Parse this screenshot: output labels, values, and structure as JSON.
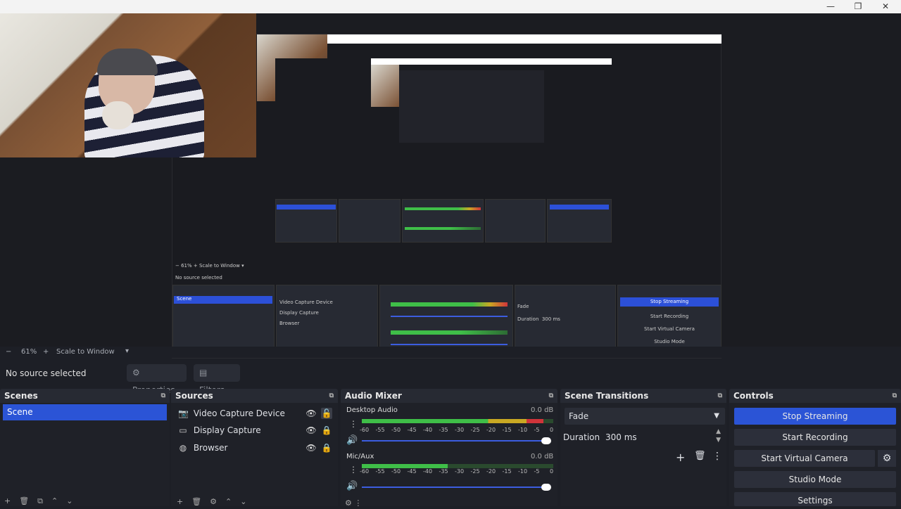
{
  "window": {
    "controls": {
      "minimize": "—",
      "maximize": "❐",
      "close": "✕"
    }
  },
  "preview": {
    "zoom_label": "61%",
    "scale_label": "Scale to Window",
    "minus": "−",
    "plus": "+",
    "dropdown": "▾"
  },
  "source_toolbar": {
    "status": "No source selected",
    "properties": "Properties",
    "filters": "Filters"
  },
  "scenes": {
    "title": "Scenes",
    "items": [
      {
        "label": "Scene"
      }
    ]
  },
  "sources": {
    "title": "Sources",
    "items": [
      {
        "label": "Video Capture Device",
        "icon": "camera-icon"
      },
      {
        "label": "Display Capture",
        "icon": "monitor-icon"
      },
      {
        "label": "Browser",
        "icon": "globe-icon"
      }
    ]
  },
  "mixer": {
    "title": "Audio Mixer",
    "channels": [
      {
        "name": "Desktop Audio",
        "db": "0.0 dB",
        "level": 0.95
      },
      {
        "name": "Mic/Aux",
        "db": "0.0 dB",
        "level": 0.45
      }
    ],
    "ticks": [
      "-60",
      "-55",
      "-50",
      "-45",
      "-40",
      "-35",
      "-30",
      "-25",
      "-20",
      "-15",
      "-10",
      "-5",
      "0"
    ]
  },
  "transitions": {
    "title": "Scene Transitions",
    "selected": "Fade",
    "duration_label": "Duration",
    "duration_value": "300 ms"
  },
  "controls": {
    "title": "Controls",
    "stop_streaming": "Stop Streaming",
    "start_recording": "Start Recording",
    "start_virtual_camera": "Start Virtual Camera",
    "studio_mode": "Studio Mode",
    "settings": "Settings"
  },
  "colors": {
    "accent": "#2b54d6",
    "meter_green": "#3fbe48",
    "meter_yellow": "#c9a823",
    "meter_red": "#d0343a"
  }
}
